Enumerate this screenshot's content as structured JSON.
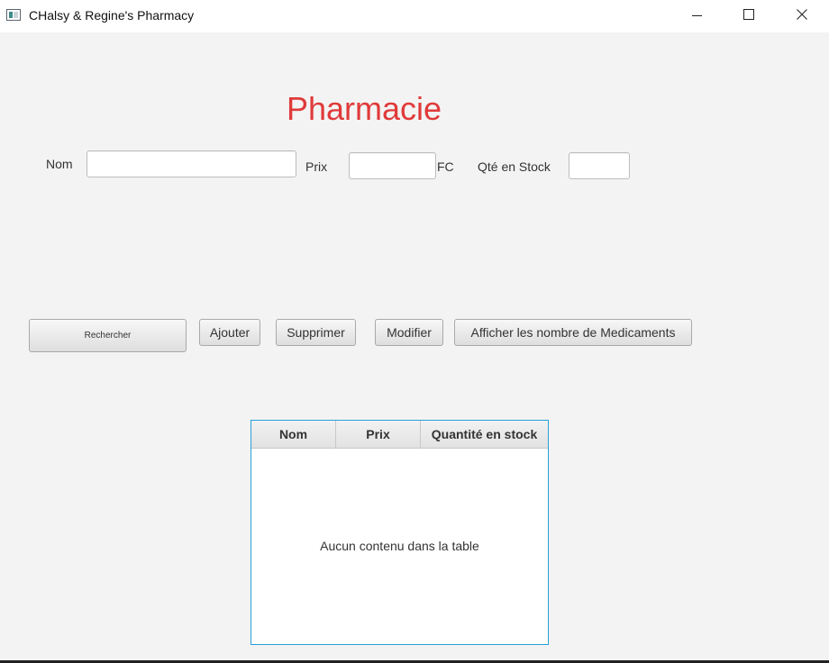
{
  "window": {
    "title": "CHalsy & Regine's Pharmacy"
  },
  "header": {
    "title": "Pharmacie",
    "title_color": "#e03a3a"
  },
  "form": {
    "nom_label": "Nom",
    "nom_value": "",
    "prix_label": "Prix",
    "prix_value": "",
    "currency_label": "FC",
    "qte_label": "Qté en Stock",
    "qte_value": ""
  },
  "toolbar": {
    "search_label": "Rechercher",
    "add_label": "Ajouter",
    "delete_label": "Supprimer",
    "edit_label": "Modifier",
    "count_label": "Afficher les nombre de Medicaments"
  },
  "table": {
    "columns": [
      "Nom",
      "Prix",
      "Quantité en stock"
    ],
    "rows": [],
    "empty_message": "Aucun contenu dans la table",
    "focus_border_color": "#2a9fd6"
  },
  "icons": {
    "app": "app-window-icon",
    "minimize": "minimize-icon",
    "maximize": "maximize-icon",
    "close": "close-icon"
  }
}
